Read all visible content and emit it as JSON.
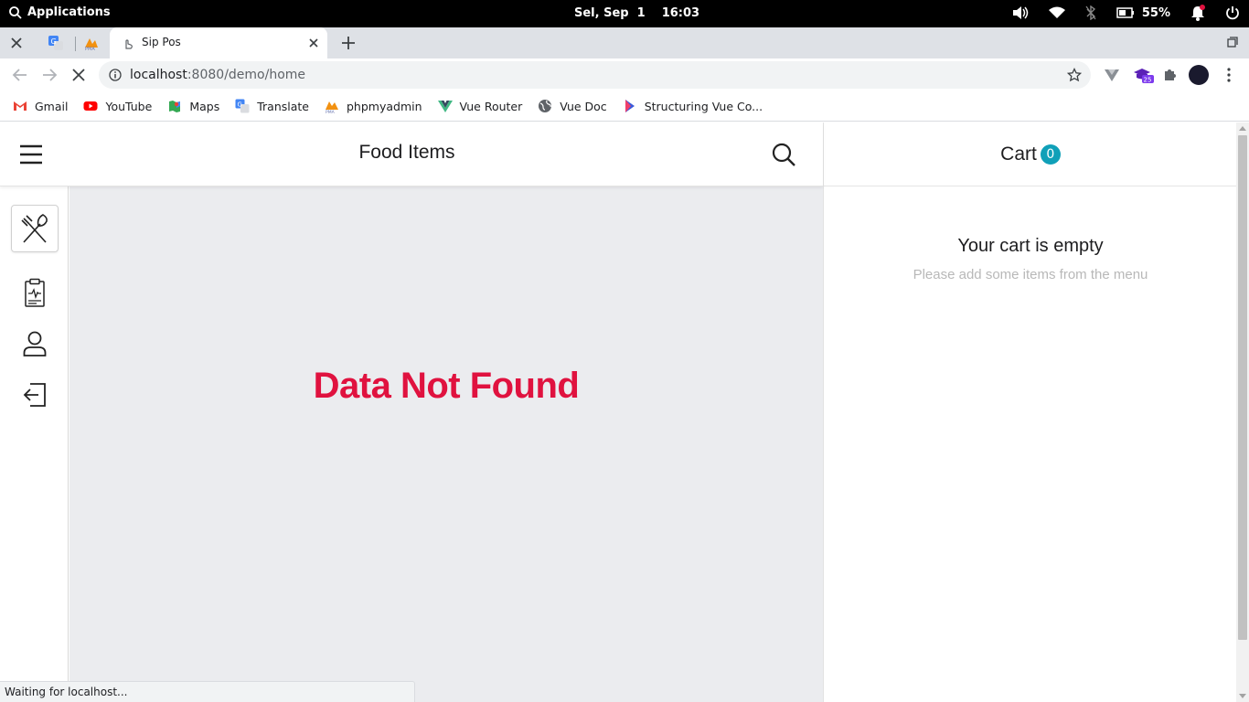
{
  "os": {
    "apps_label": "Applications",
    "date": "Sel, Sep  1",
    "time": "16:03",
    "battery": "55%"
  },
  "browser": {
    "tab_title": "Sip Pos",
    "url_host": "localhost",
    "url_rest": ":8080/demo/home",
    "extension_badge": "25",
    "status_text": "Waiting for localhost..."
  },
  "bookmarks": [
    {
      "label": "Gmail",
      "icon": "gmail-icon"
    },
    {
      "label": "YouTube",
      "icon": "youtube-icon"
    },
    {
      "label": "Maps",
      "icon": "maps-icon"
    },
    {
      "label": "Translate",
      "icon": "translate-icon"
    },
    {
      "label": "phpmyadmin",
      "icon": "phpmyadmin-icon"
    },
    {
      "label": "Vue Router",
      "icon": "vue-icon"
    },
    {
      "label": "Vue Doc",
      "icon": "globe-icon"
    },
    {
      "label": "Structuring Vue Co...",
      "icon": "bookmark-icon"
    }
  ],
  "app": {
    "title": "Food Items",
    "empty_message": "Data Not Found",
    "sidebar": [
      {
        "name": "food-menu",
        "icon": "fork-knife-icon",
        "active": true
      },
      {
        "name": "orders",
        "icon": "clipboard-icon",
        "active": false
      },
      {
        "name": "profile",
        "icon": "user-icon",
        "active": false
      },
      {
        "name": "logout",
        "icon": "logout-icon",
        "active": false
      }
    ],
    "cart": {
      "title": "Cart",
      "count": "0",
      "empty_title": "Your cart is empty",
      "empty_subtitle": "Please add some items from the menu"
    }
  },
  "colors": {
    "accent_red": "#e0123f",
    "cart_badge": "#10a0b8",
    "content_bg": "#ebecef"
  }
}
